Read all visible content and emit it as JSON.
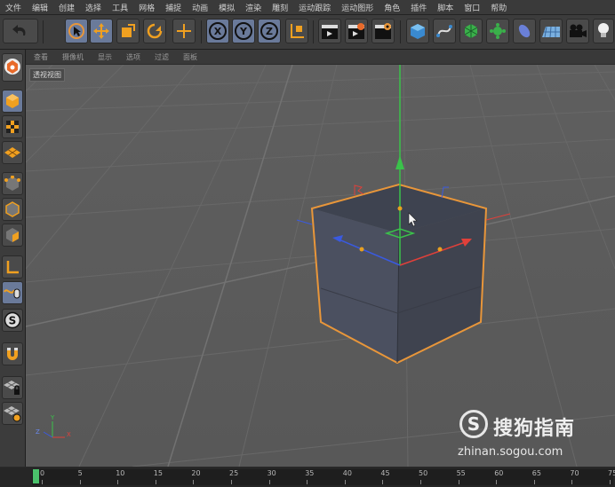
{
  "menu": [
    "文件",
    "编辑",
    "创建",
    "选择",
    "工具",
    "网格",
    "捕捉",
    "动画",
    "模拟",
    "渲染",
    "雕刻",
    "运动跟踪",
    "运动图形",
    "角色",
    "插件",
    "脚本",
    "窗口",
    "帮助"
  ],
  "toolbar": {
    "undo_icon": "undo-icon",
    "axis_x": "X",
    "axis_y": "Y",
    "axis_z": "Z"
  },
  "viewport_menu": [
    "查看",
    "摄像机",
    "显示",
    "选项",
    "过滤",
    "面板"
  ],
  "viewport": {
    "label": "透视视图",
    "axis_y": "Y",
    "axis_z": "Z",
    "axis_x": "X"
  },
  "timeline": {
    "ticks": [
      "0",
      "5",
      "10",
      "15",
      "20",
      "25",
      "30",
      "35",
      "40",
      "45",
      "50",
      "55",
      "60",
      "65",
      "70",
      "75"
    ],
    "current_frame": 0
  },
  "watermark": {
    "logo": "S",
    "title": "搜狗指南",
    "url": "zhinan.sogou.com"
  },
  "colors": {
    "selection": "#e8963a",
    "axis_x": "#e0403a",
    "axis_y": "#3ac24a",
    "axis_z": "#3a5ae0",
    "active_tool": "#6a7a9a"
  }
}
